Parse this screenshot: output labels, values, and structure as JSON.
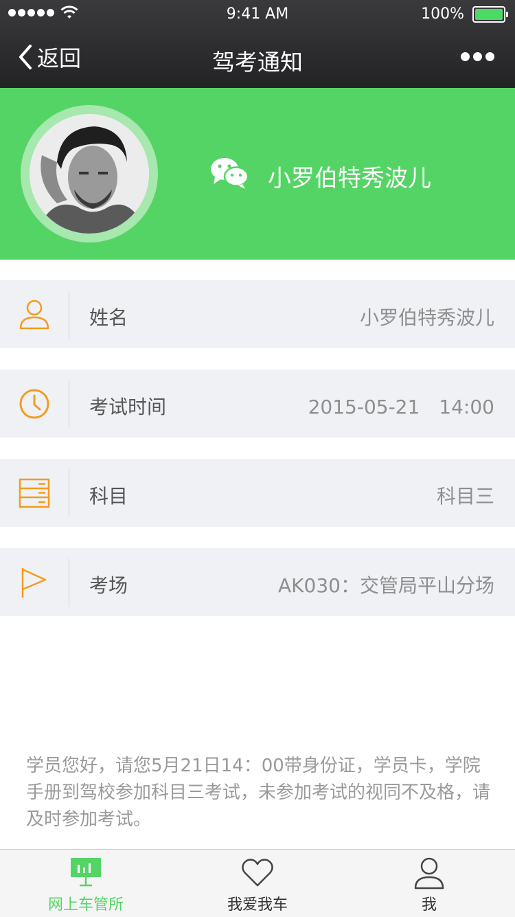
{
  "status_bar": {
    "time": "9:41 AM",
    "battery_percent": "100%",
    "signal_bars": 5,
    "battery_level": 1.0
  },
  "nav": {
    "back_label": "返回",
    "title": "驾考通知"
  },
  "profile": {
    "name": "小罗伯特秀波儿"
  },
  "info_rows": [
    {
      "icon": "user-icon",
      "label": "姓名",
      "value": "小罗伯特秀波儿"
    },
    {
      "icon": "clock-icon",
      "label": "考试时间",
      "value": "2015-05-21　14:00"
    },
    {
      "icon": "list-icon",
      "label": "科目",
      "value": "科目三"
    },
    {
      "icon": "flag-icon",
      "label": "考场",
      "value": "AK030：交管局平山分场"
    }
  ],
  "notice": "学员您好，请您5月21日14：00带身份证，学员卡，学院手册到驾校参加科目三考试，未参加考试的视同不及格，请及时参加考试。",
  "tabbar": {
    "tabs": [
      {
        "label": "网上车管所",
        "icon": "dashboard-icon",
        "active": true
      },
      {
        "label": "我爱我车",
        "icon": "heart-icon",
        "active": false
      },
      {
        "label": "我",
        "icon": "person-icon",
        "active": false
      }
    ]
  },
  "colors": {
    "brand_green": "#55d466",
    "icon_orange": "#f39c1d",
    "nav_dark": "#2b2b2d"
  }
}
